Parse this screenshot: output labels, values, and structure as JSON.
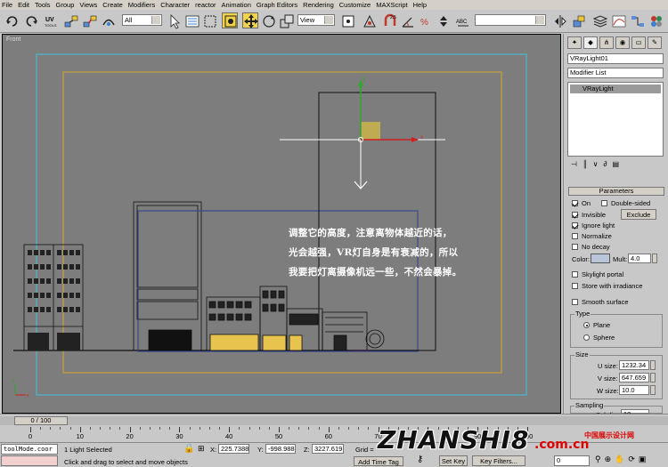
{
  "menu": [
    "File",
    "Edit",
    "Tools",
    "Group",
    "Views",
    "Create",
    "Modifiers",
    "Character",
    "reactor",
    "Animation",
    "Graph Editors",
    "Rendering",
    "Customize",
    "MAXScript",
    "Help"
  ],
  "toolbar": {
    "selection_filter": "All",
    "ref_coord": "View",
    "snap_label": "2.5",
    "abc_label": "ABC"
  },
  "viewport": {
    "label": "Front",
    "axis_x": "x",
    "axis_y": "y",
    "note_lines": [
      "调整它的高度，注意离物体越近的话，",
      "光会越强，VR灯自身是有衰减的，所以",
      "我要把灯离摄像机远一些，不然会暴掉。"
    ]
  },
  "command_panel": {
    "object_name": "VRayLight01",
    "modifier_list": "Modifier List",
    "stack_item": "VRayLight",
    "parameters_title": "Parameters",
    "on_label": "On",
    "double_sided_label": "Double-sided",
    "invisible_label": "Invisible",
    "exclude_label": "Exclude",
    "ignore_light_label": "Ignore light",
    "normalize_label": "Normalize",
    "no_decay_label": "No decay",
    "color_label": "Color:",
    "mult_label": "Mult:",
    "mult_value": "4.0",
    "skylight_label": "Skylight portal",
    "store_label": "Store with irradiance",
    "smooth_label": "Smooth surface",
    "type_label": "Type",
    "plane_label": "Plane",
    "sphere_label": "Sphere",
    "size_label": "Size",
    "u_label": "U size:",
    "u_value": "1232.34",
    "v_label": "V size:",
    "v_value": "647.659",
    "w_label": "W size:",
    "w_value": "10.0",
    "sampling_label": "Sampling",
    "subdivs_label": "Subdivs:",
    "subdivs_value": "10",
    "light_color": "#b9c6da"
  },
  "timeline": {
    "frame_counter": "0 / 100",
    "ticks": [
      "0",
      "10",
      "20",
      "30",
      "40",
      "50",
      "60",
      "70",
      "80",
      "90",
      "100"
    ]
  },
  "status": {
    "script_field": "toolMode.coor",
    "selection_text": "1 Light Selected",
    "prompt": "Click and drag to select and move objects",
    "x_label": "X:",
    "x_value": "225.7388",
    "y_label": "Y:",
    "y_value": "-998.988",
    "z_label": "Z:",
    "z_value": "3227.619",
    "grid_label": "Grid = ",
    "add_time_tag": "Add Time Tag",
    "set_key": "Set Key",
    "key_filters": "Key Filters...",
    "frame_value": "0"
  },
  "watermark": {
    "brand": "ZHANSHI8",
    "domain": ".com.cn",
    "cn": "中国展示设计网"
  }
}
